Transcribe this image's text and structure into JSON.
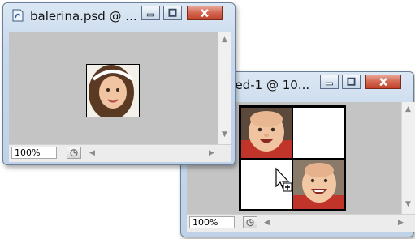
{
  "window_back": {
    "title": "balerina.psd @ ...",
    "zoom": "100%"
  },
  "window_front": {
    "title": "ded-1 @ 10...",
    "zoom": "100%"
  },
  "icons": {
    "minimize": "minimize-icon",
    "maximize": "maximize-icon",
    "close": "close-icon",
    "cursor": "arrow-cursor-icon",
    "drop": "drop-plus-icon"
  },
  "colors": {
    "canvas_gray": "#c4c4c4",
    "close_red": "#c2432b",
    "frame_blue": "#c7d8ec"
  }
}
